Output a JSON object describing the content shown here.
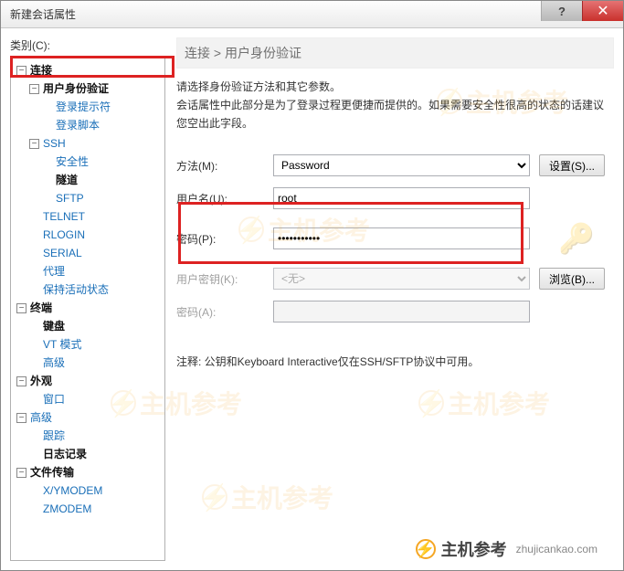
{
  "window": {
    "title": "新建会话属性"
  },
  "category_label": "类别(C):",
  "tree": {
    "connection": "连接",
    "auth": "用户身份验证",
    "login_prompt": "登录提示符",
    "login_script": "登录脚本",
    "ssh": "SSH",
    "security": "安全性",
    "tunnel": "隧道",
    "sftp": "SFTP",
    "telnet": "TELNET",
    "rlogin": "RLOGIN",
    "serial": "SERIAL",
    "proxy": "代理",
    "keepalive": "保持活动状态",
    "terminal": "终端",
    "keyboard": "键盘",
    "vtmode": "VT 模式",
    "advanced": "高级",
    "appearance": "外观",
    "window": "窗口",
    "advanced2": "高级",
    "trace": "跟踪",
    "logging": "日志记录",
    "filetransfer": "文件传输",
    "xymodem": "X/YMODEM",
    "zmodem": "ZMODEM"
  },
  "breadcrumb": "连接 > 用户身份验证",
  "desc_line1": "请选择身份验证方法和其它参数。",
  "desc_line2": "会话属性中此部分是为了登录过程更便捷而提供的。如果需要安全性很高的状态的话建议您空出此字段。",
  "form": {
    "method_label": "方法(M):",
    "method_value": "Password",
    "settings_btn": "设置(S)...",
    "username_label": "用户名(U):",
    "username_value": "root",
    "password_label": "密码(P):",
    "password_value": "•••••••••••",
    "userkey_label": "用户密钥(K):",
    "userkey_value": "<无>",
    "browse_btn": "浏览(B)...",
    "password2_label": "密码(A):"
  },
  "note": "注释: 公钥和Keyboard Interactive仅在SSH/SFTP协议中可用。",
  "watermark": {
    "text": "主机参考",
    "domain": "zhujicankao.com"
  },
  "toggles": {
    "minus": "−",
    "plus": "+"
  }
}
